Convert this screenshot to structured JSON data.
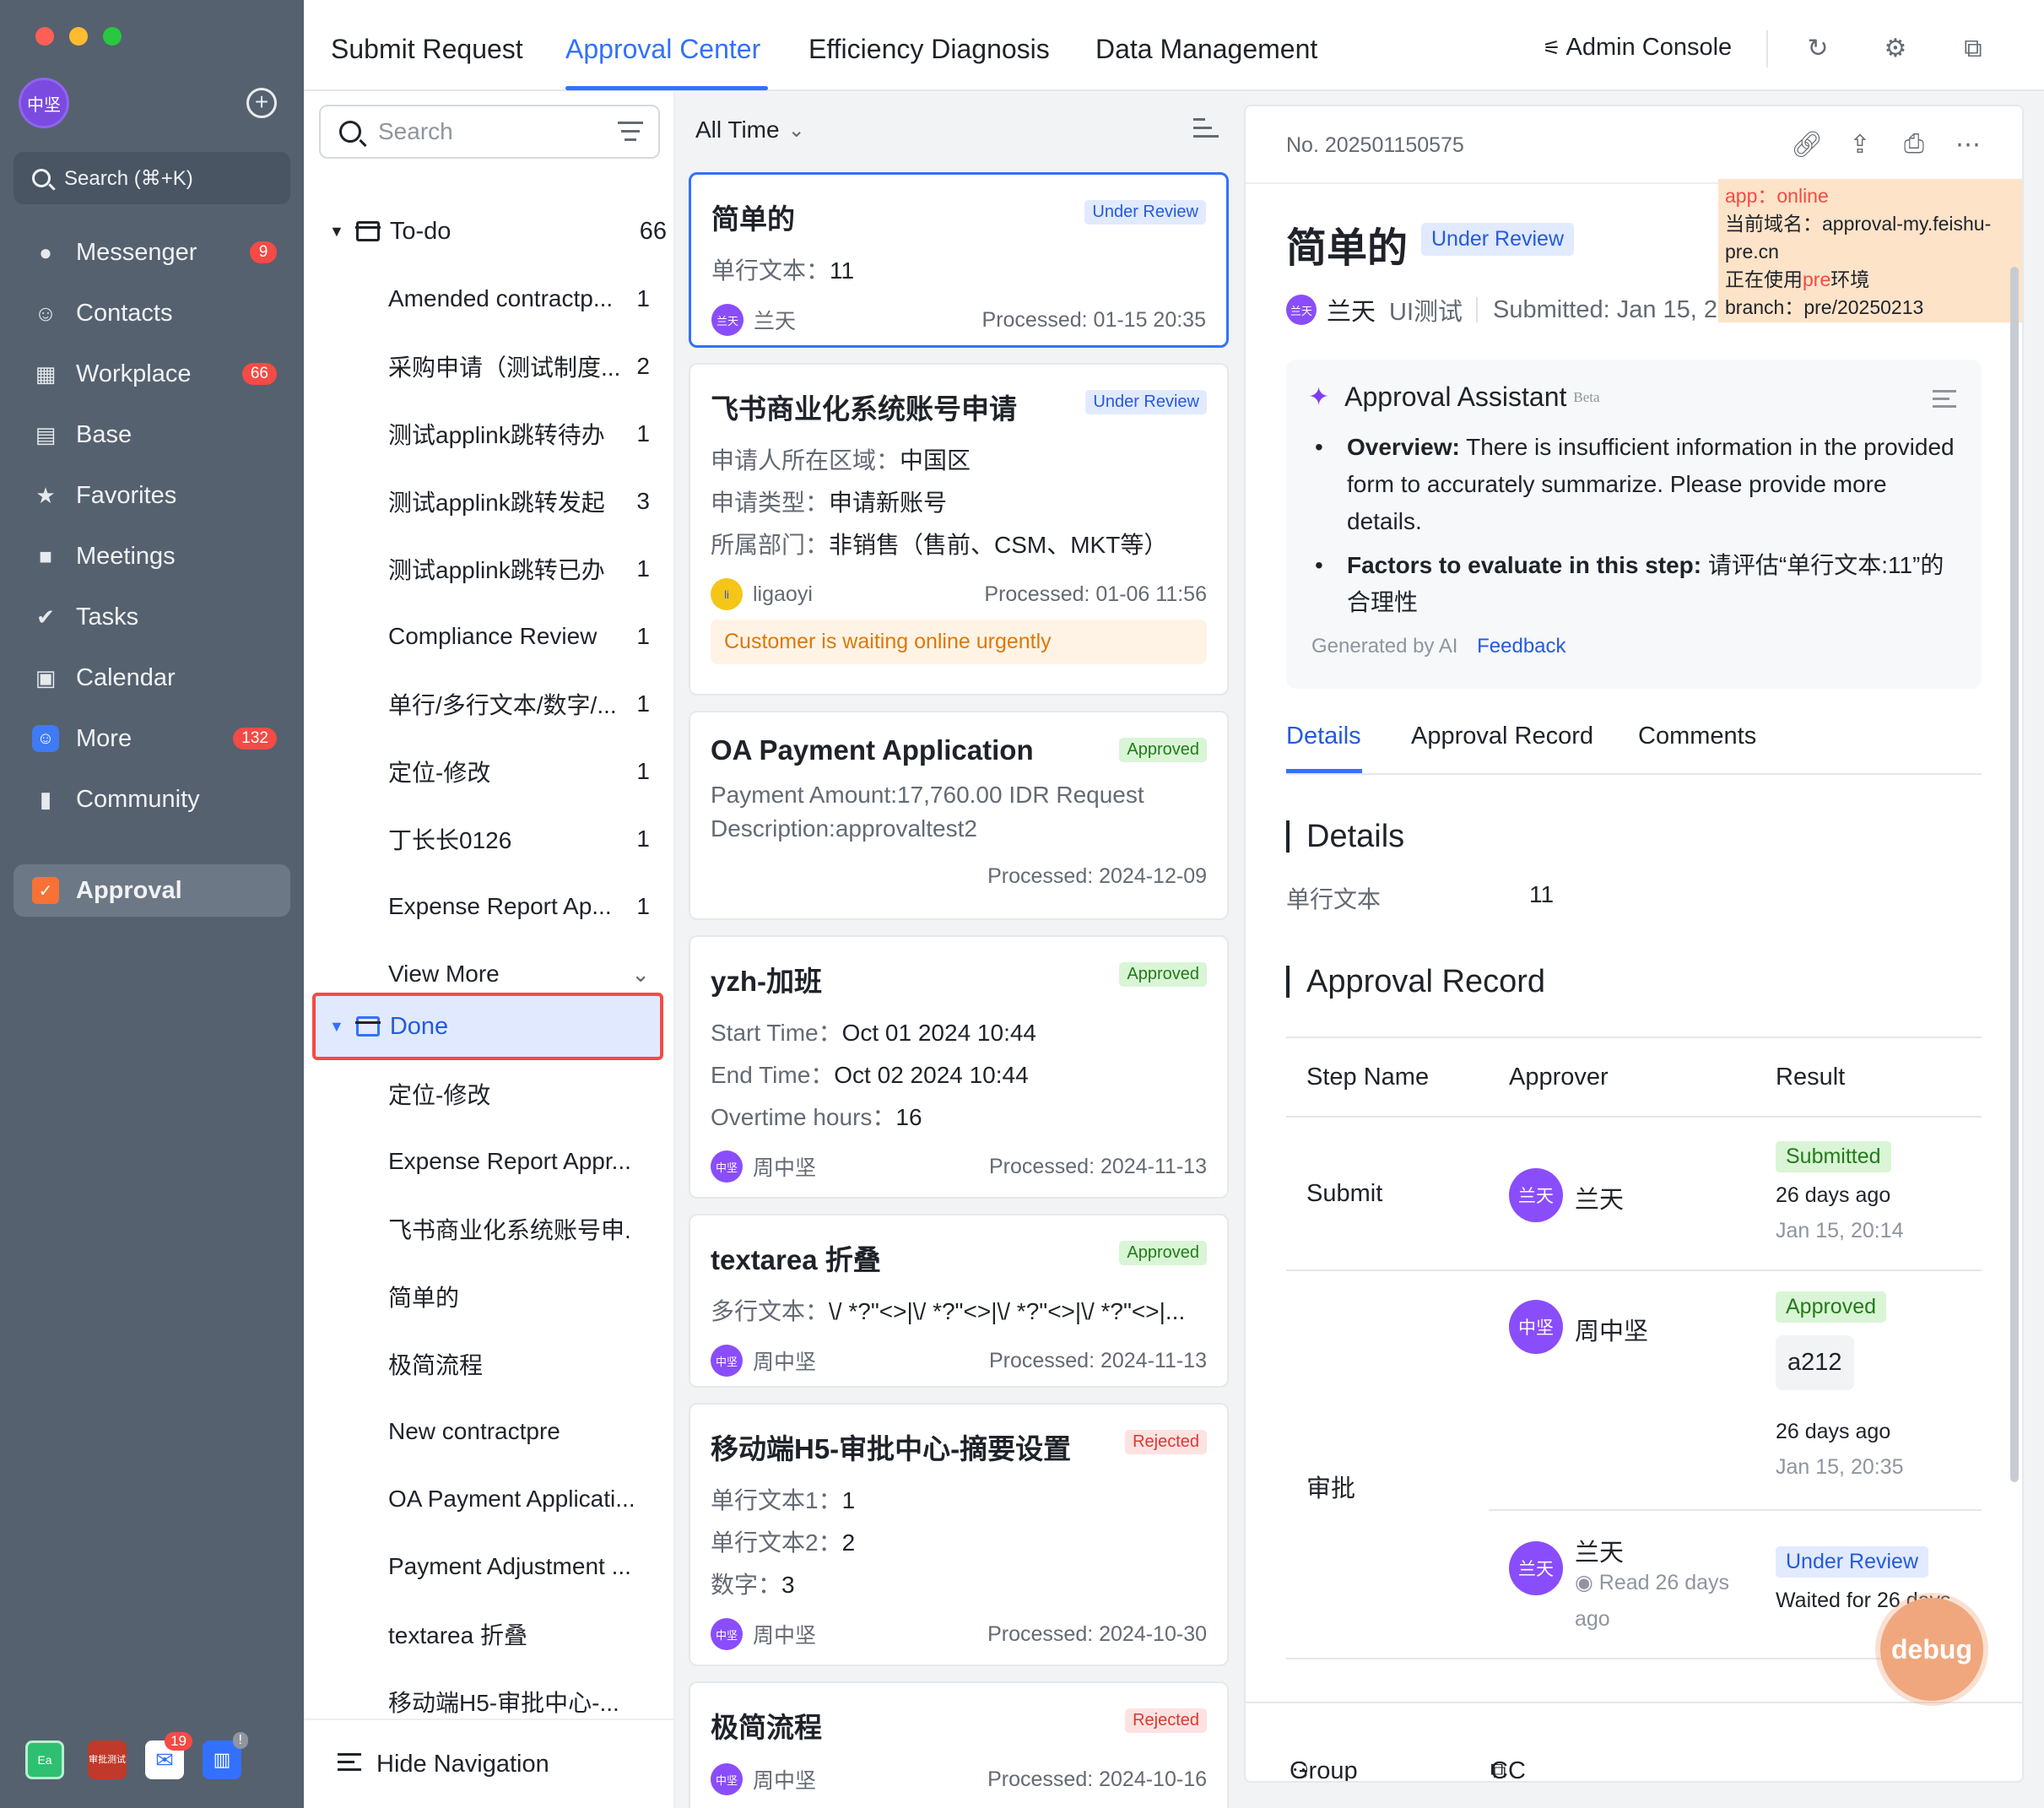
{
  "sidebar": {
    "avatar": "中坚",
    "search": "Search (⌘+K)",
    "items": [
      {
        "label": "Messenger",
        "badge": "9"
      },
      {
        "label": "Contacts",
        "badge": ""
      },
      {
        "label": "Workplace",
        "badge": "66"
      },
      {
        "label": "Base",
        "badge": ""
      },
      {
        "label": "Favorites",
        "badge": ""
      },
      {
        "label": "Meetings",
        "badge": ""
      },
      {
        "label": "Tasks",
        "badge": ""
      },
      {
        "label": "Calendar",
        "badge": ""
      },
      {
        "label": "More",
        "badge": "132"
      },
      {
        "label": "Community",
        "badge": ""
      },
      {
        "label": "Approval",
        "badge": ""
      }
    ],
    "dock": {
      "app1": "Ea",
      "app2": "审批测试",
      "mail_badge": "19",
      "alert_badge": "!"
    }
  },
  "topbar": {
    "tabs": [
      "Submit Request",
      "Approval Center",
      "Efficiency Diagnosis",
      "Data Management"
    ],
    "active_tab": "Approval Center",
    "admin": "Admin Console"
  },
  "tree": {
    "search_placeholder": "Search",
    "todo": {
      "label": "To-do",
      "count": "66"
    },
    "todo_items": [
      {
        "label": "Amended contractp...",
        "count": "1"
      },
      {
        "label": "采购申请（测试制度...",
        "count": "2"
      },
      {
        "label": "测试applink跳转待办",
        "count": "1"
      },
      {
        "label": "测试applink跳转发起",
        "count": "3"
      },
      {
        "label": "测试applink跳转已办",
        "count": "1"
      },
      {
        "label": "Compliance Review",
        "count": "1"
      },
      {
        "label": "单行/多行文本/数字/...",
        "count": "1"
      },
      {
        "label": "定位-修改",
        "count": "1"
      },
      {
        "label": "丁长长0126",
        "count": "1"
      },
      {
        "label": "Expense Report Ap...",
        "count": "1"
      }
    ],
    "view_more": "View More",
    "done": {
      "label": "Done"
    },
    "done_items": [
      "定位-修改",
      "Expense Report Appr...",
      "飞书商业化系统账号申...",
      "简单的",
      "极简流程",
      "New contractpre",
      "OA Payment Applicati...",
      "Payment Adjustment ...",
      "textarea 折叠",
      "移动端H5-审批中心-..."
    ],
    "hide_nav": "Hide Navigation"
  },
  "list": {
    "filter": "All Time",
    "cards": [
      {
        "title": "简单的",
        "status": "Under Review",
        "fields": [
          [
            "单行文本：",
            "11"
          ]
        ],
        "user": "兰天",
        "user_short": "兰天",
        "processed": "Processed: 01-15 20:35"
      },
      {
        "title": "飞书商业化系统账号申请",
        "status": "Under Review",
        "fields": [
          [
            "申请人所在区域：",
            "中国区"
          ],
          [
            "申请类型：",
            "申请新账号"
          ],
          [
            "所属部门：",
            "非销售（售前、CSM、MKT等）"
          ]
        ],
        "user": "ligaoyi",
        "user_short": "li",
        "processed": "Processed: 01-06 11:56",
        "urgent": "Customer is waiting online urgently"
      },
      {
        "title": "OA Payment Application",
        "status": "Approved",
        "fields": [
          [
            "Payment Amount:17,760.00 IDR Request",
            ""
          ],
          [
            "Description:approvaltest2",
            ""
          ]
        ],
        "processed": "Processed: 2024-12-09"
      },
      {
        "title": "yzh-加班",
        "status": "Approved",
        "fields": [
          [
            "Start Time：",
            "Oct 01 2024 10:44"
          ],
          [
            "End Time：",
            "Oct 02 2024 10:44"
          ],
          [
            "Overtime hours：",
            "16"
          ]
        ],
        "user": "周中坚",
        "user_short": "中坚",
        "processed": "Processed: 2024-11-13"
      },
      {
        "title": "textarea 折叠",
        "status": "Approved",
        "fields": [
          [
            "多行文本：",
            "\\/ *?\"<>|\\/ *?\"<>|\\/ *?\"<>|\\/ *?\"<>|..."
          ]
        ],
        "user": "周中坚",
        "user_short": "中坚",
        "processed": "Processed: 2024-11-13"
      },
      {
        "title": "移动端H5-审批中心-摘要设置",
        "status": "Rejected",
        "fields": [
          [
            "单行文本1：",
            "1"
          ],
          [
            "单行文本2：",
            "2"
          ],
          [
            "数字：",
            "3"
          ]
        ],
        "user": "周中坚",
        "user_short": "中坚",
        "processed": "Processed: 2024-10-30"
      },
      {
        "title": "极简流程",
        "status": "Rejected",
        "fields": [],
        "user": "周中坚",
        "user_short": "中坚",
        "processed": "Processed: 2024-10-16"
      }
    ]
  },
  "detail": {
    "number": "No. 202501150575",
    "title": "简单的",
    "status": "Under Review",
    "submitter_short": "兰天",
    "submitter": "兰天",
    "dept": "UI测试",
    "submitted": "Submitted: Jan 15, 2(",
    "debug": {
      "app_label": "app：",
      "app_value": "online",
      "domain": "当前域名：approval-my.feishu-pre.cn",
      "env_prefix": "正在使用",
      "env_value": "pre",
      "env_suffix": "环境",
      "branch": "branch：pre/20250213"
    },
    "assistant": {
      "title": "Approval Assistant",
      "beta": "Beta",
      "overview_label": "Overview:",
      "overview_text": " There is insufficient information in the provided form to accurately summarize. Please provide more details.",
      "factors_label": "Factors to evaluate in this step:",
      "factors_text": " 请评估“单行文本:11”的合理性",
      "generated": "Generated by AI",
      "feedback": "Feedback"
    },
    "tabs": [
      "Details",
      "Approval Record",
      "Comments"
    ],
    "details_heading": "Details",
    "field_label": "单行文本",
    "field_value": "11",
    "record_heading": "Approval Record",
    "record_cols": [
      "Step Name",
      "Approver",
      "Result"
    ],
    "records": {
      "submit_step": "Submit",
      "submit_avatar": "兰天",
      "submit_name": "兰天",
      "submit_result": "Submitted",
      "submit_ago": "26 days ago",
      "submit_time": "Jan 15, 20:14",
      "approve_step": "审批",
      "approver1_avatar": "中坚",
      "approver1_name": "周中坚",
      "approver1_result": "Approved",
      "approver1_comment": "a212",
      "approver1_ago": "26 days ago",
      "approver1_time": "Jan 15, 20:35",
      "approver2_avatar": "兰天",
      "approver2_name": "兰天",
      "approver2_read": "Read 26 days",
      "approver2_read2": "ago",
      "approver2_result": "Under Review",
      "approver2_wait": "Waited for 26 days"
    },
    "bottom": {
      "group_chat": "Group Chat",
      "cc": "CC"
    },
    "debug_button": "debug"
  }
}
